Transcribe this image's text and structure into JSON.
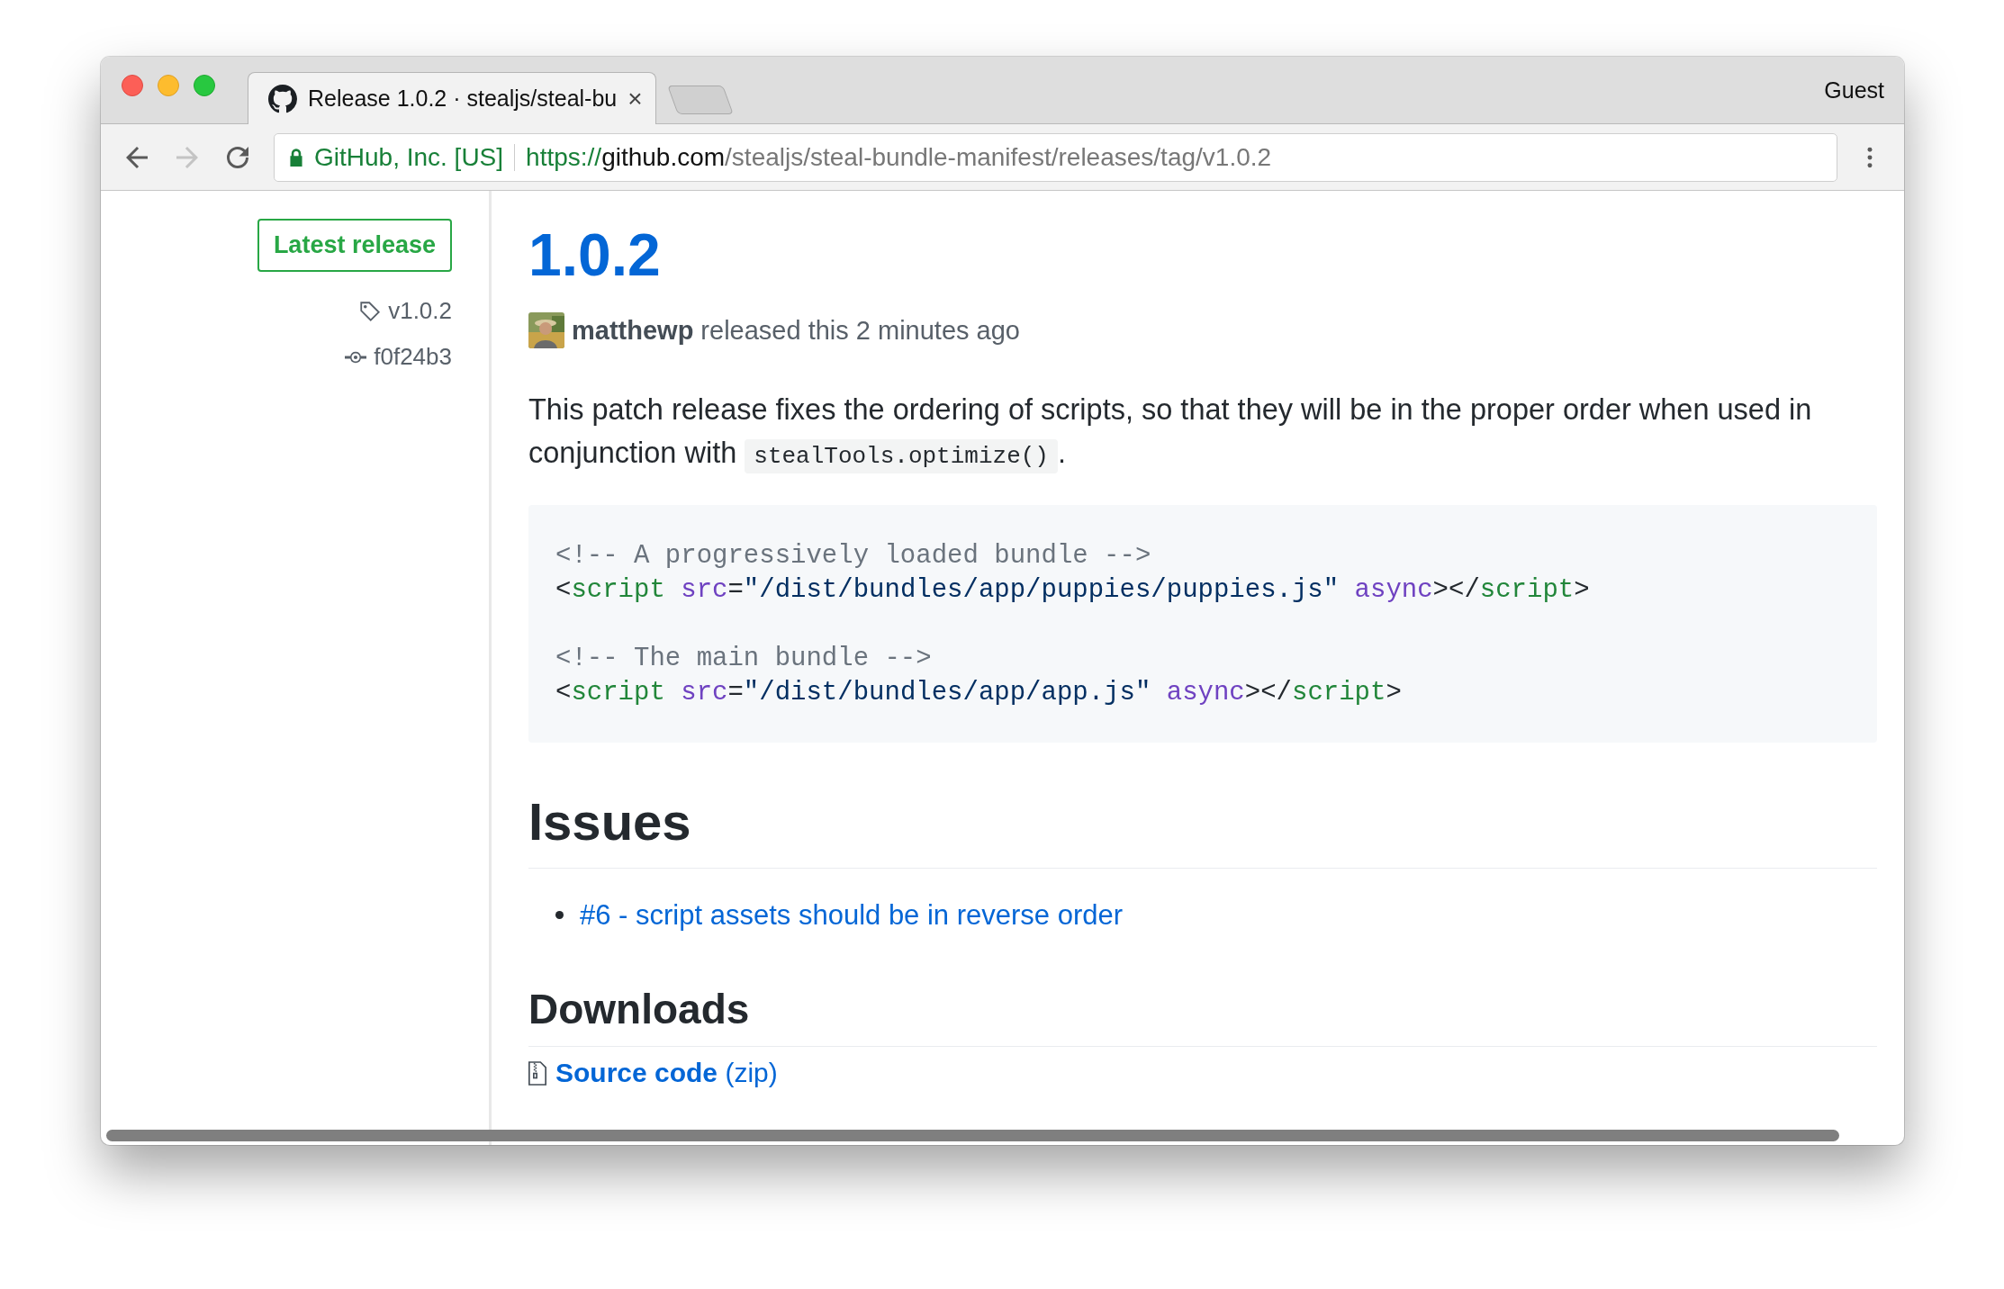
{
  "window": {
    "tabs": [
      {
        "title": "Release 1.0.2 · stealjs/steal-bu",
        "close": "×",
        "selected": true
      }
    ],
    "profile": "Guest"
  },
  "toolbar": {
    "nav_buttons": [
      {
        "kind": "back",
        "disabled": false
      },
      {
        "kind": "forward",
        "disabled": true
      },
      {
        "kind": "reload",
        "disabled": false
      }
    ],
    "address_bar": {
      "security_label": "GitHub, Inc. [US]",
      "scheme": "https://",
      "host": "github.com",
      "path": "/stealjs/steal-bundle-manifest/releases/tag/v1.0.2"
    }
  },
  "sidebar": {
    "badge": "Latest release",
    "tag": "v1.0.2",
    "commit": "f0f24b3"
  },
  "release": {
    "title": "1.0.2",
    "author": "matthewp",
    "byline": "released this 2 minutes ago",
    "description": {
      "before": "This patch release fixes the ordering of scripts, so that they will be in the proper order when used in conjunction with ",
      "code": "stealTools.optimize()",
      "after": "."
    },
    "code_block": [
      {
        "comment": "<!-- A progressively loaded bundle -->",
        "tokens": [
          {
            "text": "<",
            "kind": "punct"
          },
          {
            "text": "script",
            "kind": "tag"
          },
          {
            "text": " src",
            "kind": "attr"
          },
          {
            "text": "=",
            "kind": "punct"
          },
          {
            "text": "\"/dist/bundles/app/puppies/puppies.js\"",
            "kind": "string"
          },
          {
            "text": " async",
            "kind": "attr"
          },
          {
            "text": "></",
            "kind": "punct"
          },
          {
            "text": "script",
            "kind": "tag"
          },
          {
            "text": ">",
            "kind": "punct"
          }
        ]
      },
      {
        "comment": "<!-- The main bundle -->",
        "tokens": [
          {
            "text": "<",
            "kind": "punct"
          },
          {
            "text": "script",
            "kind": "tag"
          },
          {
            "text": " src",
            "kind": "attr"
          },
          {
            "text": "=",
            "kind": "punct"
          },
          {
            "text": "\"/dist/bundles/app/app.js\"",
            "kind": "string"
          },
          {
            "text": " async",
            "kind": "attr"
          },
          {
            "text": "></",
            "kind": "punct"
          },
          {
            "text": "script",
            "kind": "tag"
          },
          {
            "text": ">",
            "kind": "punct"
          }
        ]
      }
    ],
    "issues_heading": "Issues",
    "issues": [
      "#6 - script assets should be in reverse order"
    ],
    "downloads_heading": "Downloads",
    "downloads": [
      "**Source code** (zip)"
    ]
  }
}
